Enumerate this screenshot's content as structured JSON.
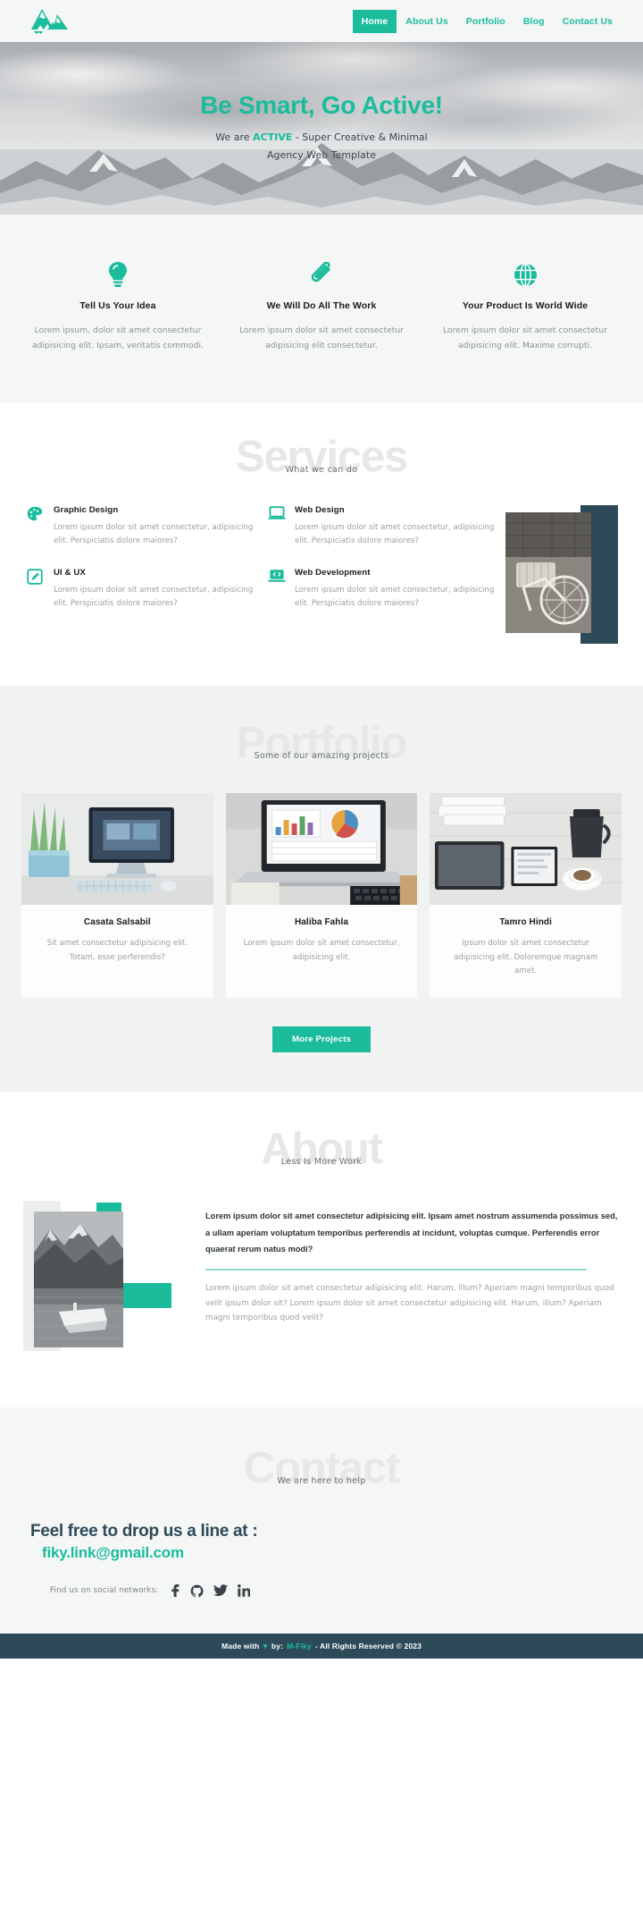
{
  "theme": {
    "accent": "#1abc9c",
    "dark": "#2d4a58",
    "light_bg": "#f5f6f6",
    "ghost": "#e6e7e8",
    "muted_text": "#9aa0a4"
  },
  "navbar": {
    "logo_name": "mountains-logo",
    "links": [
      {
        "label": "Home",
        "active": true
      },
      {
        "label": "About Us",
        "active": false
      },
      {
        "label": "Portfolio",
        "active": false
      },
      {
        "label": "Blog",
        "active": false
      },
      {
        "label": "Contact Us",
        "active": false
      }
    ]
  },
  "hero": {
    "title": "Be Smart, Go Active!",
    "sub_pre": "We are ",
    "sub_accent": "ACTIVE",
    "sub_post": " - Super Creative & Minimal",
    "sub_line2": "Agency Web Template"
  },
  "features": [
    {
      "icon": "lightbulb-icon",
      "title": "Tell Us Your Idea",
      "text": "Lorem ipsum, dolor sit amet consectetur adipisicing elit. Ipsam, veritatis commodi."
    },
    {
      "icon": "paperclip-icon",
      "title": "We Will Do All The Work",
      "text": "Lorem ipsum dolor sit amet consectetur adipisicing elit consectetur."
    },
    {
      "icon": "globe-icon",
      "title": "Your Product Is World Wide",
      "text": "Lorem ipsum dolor sit amet consectetur adipisicing elit. Maxime corrupti."
    }
  ],
  "services": {
    "ghost_title": "Services",
    "subtitle": "What we can do",
    "items": [
      {
        "icon": "palette-icon",
        "title": "Graphic Design",
        "text": "Lorem ipsum dolor sit amet consectetur, adipisicing elit. Perspiciatis dolore maiores?"
      },
      {
        "icon": "monitor-icon",
        "title": "Web Design",
        "text": "Lorem ipsum dolor sit amet consectetur, adipisicing elit. Perspiciatis dolore maiores?"
      },
      {
        "icon": "pencil-square-icon",
        "title": "UI & UX",
        "text": "Lorem ipsum dolor sit amet consectetur, adipisicing elit. Perspiciatis dolore maiores?"
      },
      {
        "icon": "code-laptop-icon",
        "title": "Web Development",
        "text": "Lorem ipsum dolor sit amet consectetur, adipisicing elit. Perspiciatis dolore maiores?"
      }
    ],
    "image_alt": "bicycle-basket-photo"
  },
  "portfolio": {
    "ghost_title": "Portfolio",
    "subtitle": "Some of our amazing projects",
    "cards": [
      {
        "image_alt": "imac-desk-photo",
        "title": "Casata Salsabil",
        "text": "Sit amet consectetur adipisicing elit. Totam, esse perferendis?"
      },
      {
        "image_alt": "laptop-charts-photo",
        "title": "Haliba Fahla",
        "text": "Lorem ipsum dolor sit amet consectetur, adipisicing elit."
      },
      {
        "image_alt": "coffee-tablet-photo",
        "title": "Tamro Hindi",
        "text": "Ipsum dolor sit amet consectetur adipisicing elit. Doloremque magnam amet."
      }
    ],
    "button_label": "More Projects"
  },
  "about": {
    "ghost_title": "About",
    "subtitle": "Less Is More Work",
    "image_alt": "lake-boat-photo",
    "lead": "Lorem ipsum dolor sit amet consectetur adipisicing elit. Ipsam amet nostrum assumenda possimus sed, a ullam aperiam voluptatum temporibus perferendis at incidunt, voluptas cumque. Perferendis error quaerat rerum natus modi?",
    "text": "Lorem ipsum dolor sit amet consectetur adipisicing elit. Harum, illum? Aperiam magni temporibus quod velit ipsum dolor sit? Lorem ipsum dolor sit amet consectetur adipisicing elit. Harum, illum? Aperiam magni temporibus quod velit?"
  },
  "contact": {
    "ghost_title": "Contact",
    "subtitle": "We are here to help",
    "headline": "Feel free to drop us a line at :",
    "email": "fiky.link@gmail.com",
    "socials_label": "Find us on social networks:",
    "socials": [
      {
        "icon": "facebook-icon",
        "name": "Facebook"
      },
      {
        "icon": "github-icon",
        "name": "GitHub"
      },
      {
        "icon": "twitter-icon",
        "name": "Twitter"
      },
      {
        "icon": "linkedin-icon",
        "name": "LinkedIn"
      }
    ]
  },
  "footer": {
    "made_with": "Made with",
    "heart": "♥",
    "by": "by:",
    "brand": "M-Fiky",
    "rights": "- All Rights Reserved © 2023"
  }
}
